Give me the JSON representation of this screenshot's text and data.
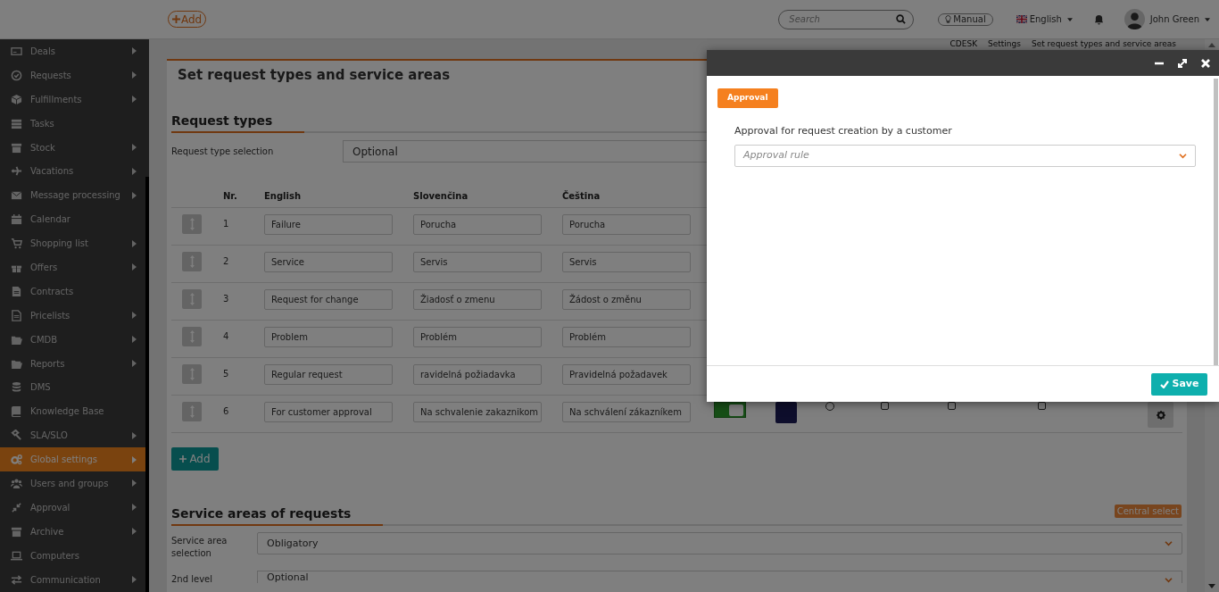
{
  "header": {
    "add_button": "Add",
    "search": {
      "placeholder": "Search"
    },
    "manual": "Manual",
    "language": "English",
    "user": "John Green"
  },
  "sidebar": {
    "items": [
      {
        "label": "Deals",
        "has_submenu": true,
        "selected": false
      },
      {
        "label": "Requests",
        "has_submenu": true,
        "selected": false
      },
      {
        "label": "Fulfillments",
        "has_submenu": true,
        "selected": false
      },
      {
        "label": "Tasks",
        "has_submenu": false,
        "selected": false
      },
      {
        "label": "Stock",
        "has_submenu": true,
        "selected": false
      },
      {
        "label": "Vacations",
        "has_submenu": true,
        "selected": false
      },
      {
        "label": "Message processing",
        "has_submenu": true,
        "selected": false
      },
      {
        "label": "Calendar",
        "has_submenu": false,
        "selected": false
      },
      {
        "label": "Shopping list",
        "has_submenu": true,
        "selected": false
      },
      {
        "label": "Offers",
        "has_submenu": true,
        "selected": false
      },
      {
        "label": "Contracts",
        "has_submenu": false,
        "selected": false
      },
      {
        "label": "Pricelists",
        "has_submenu": true,
        "selected": false
      },
      {
        "label": "CMDB",
        "has_submenu": true,
        "selected": false
      },
      {
        "label": "Reports",
        "has_submenu": true,
        "selected": false
      },
      {
        "label": "DMS",
        "has_submenu": false,
        "selected": false
      },
      {
        "label": "Knowledge Base",
        "has_submenu": false,
        "selected": false
      },
      {
        "label": "SLA/SLO",
        "has_submenu": true,
        "selected": false
      },
      {
        "label": "Global settings",
        "has_submenu": true,
        "selected": true
      },
      {
        "label": "Users and groups",
        "has_submenu": true,
        "selected": false
      },
      {
        "label": "Approval",
        "has_submenu": true,
        "selected": false
      },
      {
        "label": "Archive",
        "has_submenu": true,
        "selected": false
      },
      {
        "label": "Computers",
        "has_submenu": false,
        "selected": false
      },
      {
        "label": "Communication",
        "has_submenu": true,
        "selected": false
      }
    ]
  },
  "breadcrumb": [
    "CDESK",
    "Settings",
    "Set request types and service areas"
  ],
  "page": {
    "title": "Set request types and service areas",
    "request_types": {
      "heading": "Request types",
      "selection_label": "Request type selection",
      "selection_value": "Optional",
      "columns": [
        "Nr.",
        "English",
        "Slovenčina",
        "Čeština"
      ],
      "rows": [
        {
          "nr": "1",
          "english": "Failure",
          "slovak": "Porucha",
          "czech": "Porucha"
        },
        {
          "nr": "2",
          "english": "Service",
          "slovak": "Servis",
          "czech": "Servis"
        },
        {
          "nr": "3",
          "english": "Request for change",
          "slovak": "Žiadosť o zmenu",
          "czech": "Žádost o změnu"
        },
        {
          "nr": "4",
          "english": "Problem",
          "slovak": "Problém",
          "czech": "Problém"
        },
        {
          "nr": "5",
          "english": "Regular request",
          "slovak": "ravidelná požiadavka",
          "czech": "Pravidelná požadavek"
        },
        {
          "nr": "6",
          "english": "For customer approval",
          "slovak": "Na schvalenie zakaznikom",
          "czech": "Na schválení zákazníkem",
          "active": true,
          "color": "#0e0e2c",
          "default": false,
          "flags": [
            false,
            false,
            false
          ]
        }
      ],
      "add_button": "Add"
    },
    "service_areas": {
      "heading": "Service areas of requests",
      "badge": "Central select",
      "fields": [
        {
          "label": "Service area selection",
          "value": "Obligatory"
        },
        {
          "label": "2nd level",
          "value": "Optional"
        }
      ]
    }
  },
  "modal": {
    "section_button": "Approval",
    "field_label": "Approval for request creation by a customer",
    "select": {
      "placeholder": "Approval rule"
    },
    "save_button": "Save"
  }
}
